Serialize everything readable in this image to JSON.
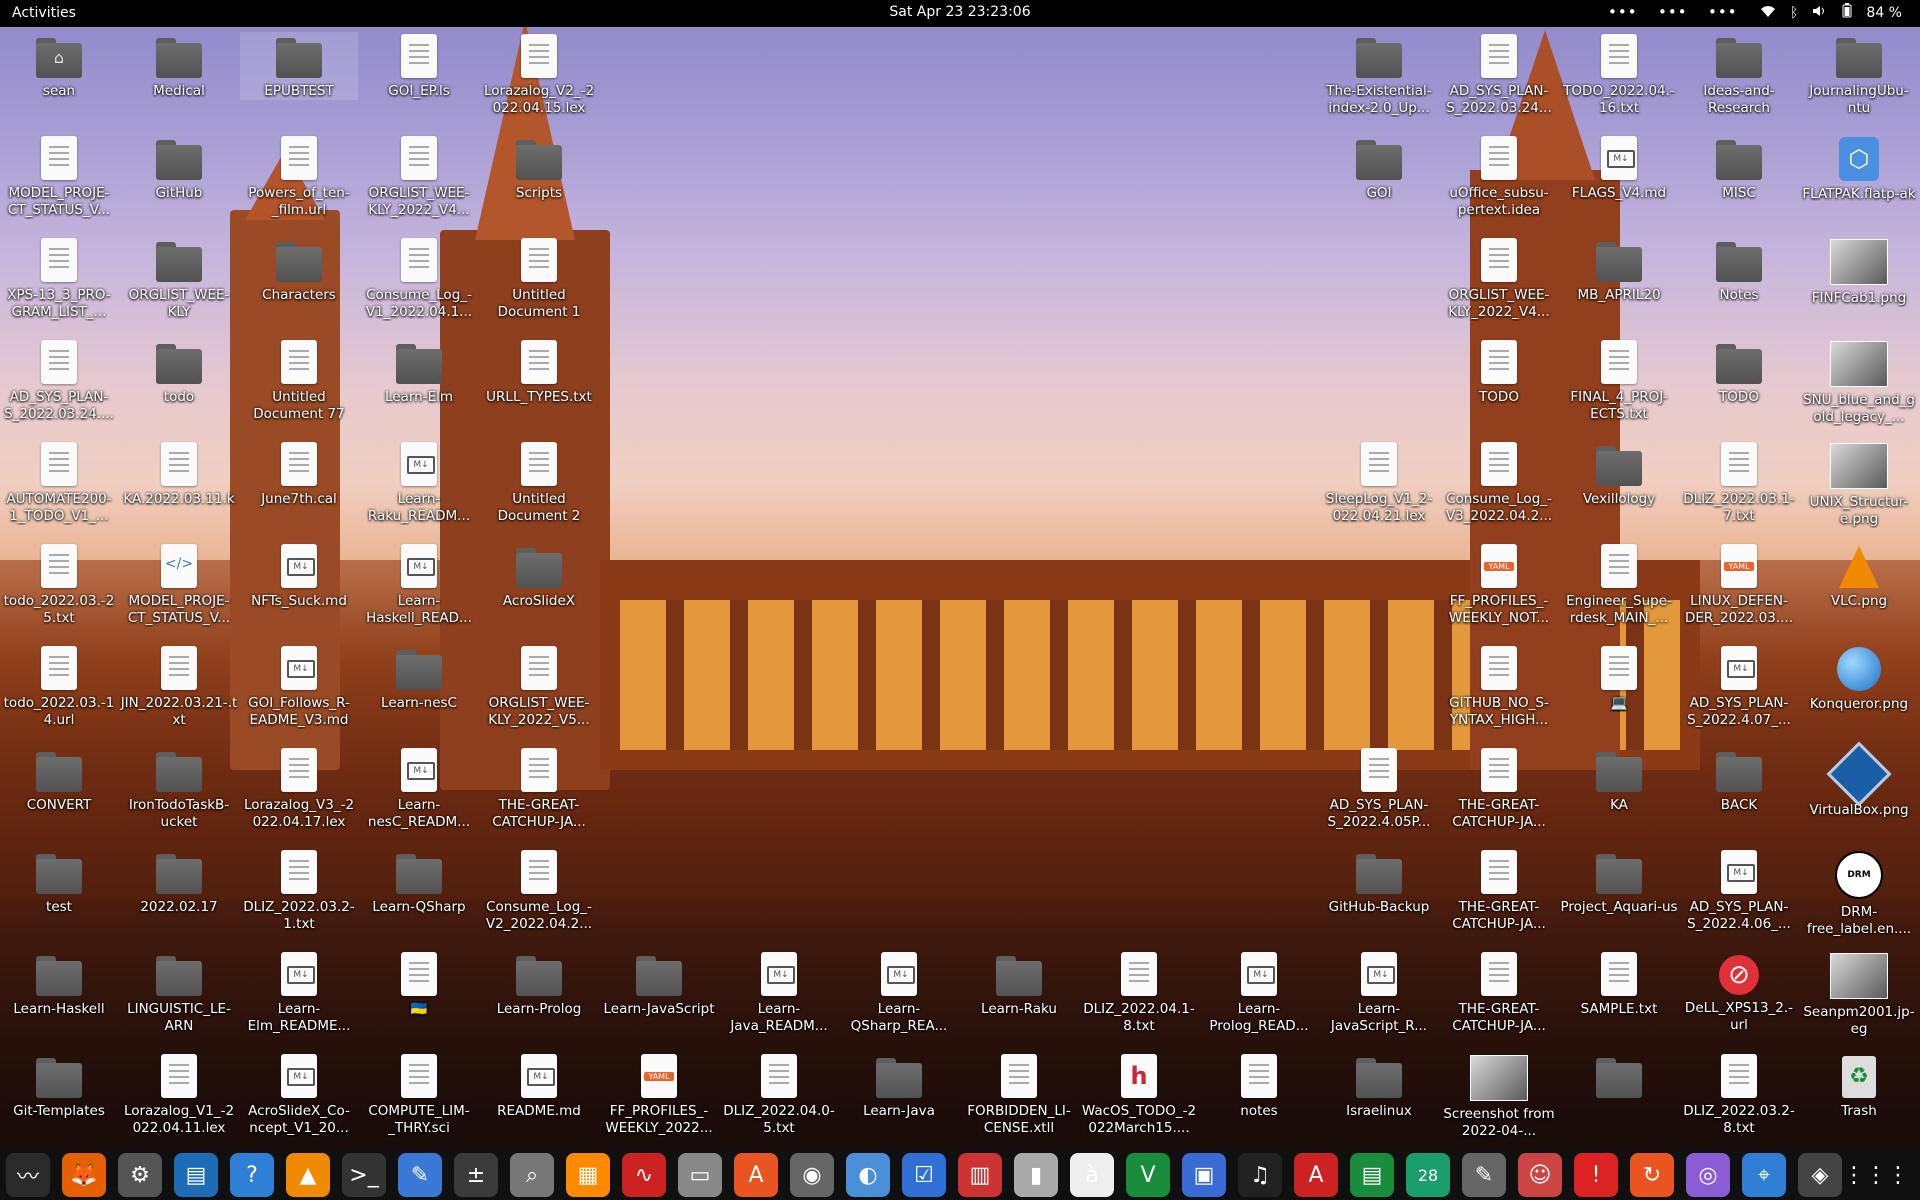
{
  "topbar": {
    "activities": "Activities",
    "clock": "Sat Apr 23  23:23:06",
    "battery": "84 %",
    "overflow": "•••"
  },
  "icons": [
    {
      "label": "sean",
      "kind": "home"
    },
    {
      "label": "Medical",
      "kind": "folder"
    },
    {
      "label": "EPUBTEST",
      "kind": "folder"
    },
    {
      "label": "GOI_EP.ls",
      "kind": "doc"
    },
    {
      "label": "Lorazalog_V2_-2022.04.15.lex",
      "kind": "doc"
    },
    {
      "label": "MODEL_PROJE-CT_STATUS_V...",
      "kind": "doc"
    },
    {
      "label": "GitHub",
      "kind": "folder"
    },
    {
      "label": "Powers_of_ten-_film.url",
      "kind": "doc"
    },
    {
      "label": "ORGLIST_WEE-KLY_2022_V4...",
      "kind": "doc"
    },
    {
      "label": "Scripts",
      "kind": "folder"
    },
    {
      "label": "XPS-13_3_PRO-GRAM_LIST_...",
      "kind": "doc"
    },
    {
      "label": "ORGLIST_WEE-KLY",
      "kind": "folder"
    },
    {
      "label": "Characters",
      "kind": "folder"
    },
    {
      "label": "Consume_Log_-V1_2022.04.1...",
      "kind": "doc"
    },
    {
      "label": "Untitled Document 1",
      "kind": "doc"
    },
    {
      "label": "AD_SYS_PLAN-S_2022.03.24....",
      "kind": "doc"
    },
    {
      "label": "todo",
      "kind": "folder"
    },
    {
      "label": "Untitled Document 77",
      "kind": "doc"
    },
    {
      "label": "Learn-Elm",
      "kind": "folder"
    },
    {
      "label": "URLL_TYPES.txt",
      "kind": "doc"
    },
    {
      "label": "AUTOMATE200-1_TODO_V1_...",
      "kind": "doc"
    },
    {
      "label": "KA.2022.03.11.k",
      "kind": "doc"
    },
    {
      "label": "June7th.cal",
      "kind": "doc"
    },
    {
      "label": "Learn-Raku_READM...",
      "kind": "md"
    },
    {
      "label": "Untitled Document 2",
      "kind": "doc"
    },
    {
      "label": "todo_2022.03.-25.txt",
      "kind": "doc"
    },
    {
      "label": "MODEL_PROJE-CT_STATUS_V...",
      "kind": "code"
    },
    {
      "label": "NFTs_Suck.md",
      "kind": "md"
    },
    {
      "label": "Learn-Haskell_READ...",
      "kind": "md"
    },
    {
      "label": "AcroSlideX",
      "kind": "folder"
    },
    {
      "label": "todo_2022.03.-14.url",
      "kind": "doc"
    },
    {
      "label": "JIN_2022.03.21-.txt",
      "kind": "doc"
    },
    {
      "label": "GOI_Follows_R-EADME_V3.md",
      "kind": "md"
    },
    {
      "label": "Learn-nesC",
      "kind": "folder"
    },
    {
      "label": "ORGLIST_WEE-KLY_2022_V5...",
      "kind": "doc"
    },
    {
      "label": "CONVERT",
      "kind": "folder"
    },
    {
      "label": "IronTodoTaskB-ucket",
      "kind": "folder"
    },
    {
      "label": "Lorazalog_V3_-2022.04.17.lex",
      "kind": "doc"
    },
    {
      "label": "Learn-nesC_READM...",
      "kind": "md"
    },
    {
      "label": "THE-GREAT-CATCHUP-JA...",
      "kind": "doc"
    },
    {
      "label": "test",
      "kind": "folder"
    },
    {
      "label": "2022.02.17",
      "kind": "folder"
    },
    {
      "label": "DLIZ_2022.03.2-1.txt",
      "kind": "doc"
    },
    {
      "label": "Learn-QSharp",
      "kind": "folder"
    },
    {
      "label": "Consume_Log_-V2_2022.04.2...",
      "kind": "doc"
    },
    {
      "label": "Learn-Haskell",
      "kind": "folder"
    },
    {
      "label": "LINGUISTIC_LE-ARN",
      "kind": "folder"
    },
    {
      "label": "Learn-Elm_README...",
      "kind": "md"
    },
    {
      "label": "🇺🇦",
      "kind": "doc"
    },
    {
      "label": "Learn-Prolog",
      "kind": "folder"
    },
    {
      "label": "Learn-JavaScript",
      "kind": "folder"
    },
    {
      "label": "Learn-Java_READM...",
      "kind": "md"
    },
    {
      "label": "Learn-QSharp_REA...",
      "kind": "md"
    },
    {
      "label": "Learn-Raku",
      "kind": "folder"
    },
    {
      "label": "DLIZ_2022.04.1-8.txt",
      "kind": "doc"
    },
    {
      "label": "Learn-Prolog_READ...",
      "kind": "md"
    },
    {
      "label": "Learn-JavaScript_R...",
      "kind": "md"
    },
    {
      "label": "THE-GREAT-CATCHUP-JA...",
      "kind": "doc"
    },
    {
      "label": "SAMPLE.txt",
      "kind": "doc"
    },
    {
      "label": "DeLL_XPS13_2.-url",
      "kind": "stop"
    },
    {
      "label": "Seanpm2001.jp-eg",
      "kind": "image"
    },
    {
      "label": "Git-Templates",
      "kind": "folder"
    },
    {
      "label": "Lorazalog_V1_-2022.04.11.lex",
      "kind": "doc"
    },
    {
      "label": "AcroSlideX_Co-ncept_V1_20...",
      "kind": "md"
    },
    {
      "label": "COMPUTE_LIM-_THRY.sci",
      "kind": "doc"
    },
    {
      "label": "README.md",
      "kind": "md"
    },
    {
      "label": "FF_PROFILES_-WEEKLY_2022...",
      "kind": "yaml"
    },
    {
      "label": "DLIZ_2022.04.0-5.txt",
      "kind": "doc"
    },
    {
      "label": "Learn-Java",
      "kind": "folder"
    },
    {
      "label": "FORBIDDEN_LI-CENSE.xtll",
      "kind": "doc"
    },
    {
      "label": "WacOS_TODO_-2022March15....",
      "kind": "h"
    },
    {
      "label": "notes",
      "kind": "doc"
    },
    {
      "label": "Israelinux",
      "kind": "folder"
    },
    {
      "label": "Screenshot from 2022-04-...",
      "kind": "image"
    },
    {
      "label": "",
      "kind": "folder"
    },
    {
      "label": "DLIZ_2022.03.2-8.txt",
      "kind": "doc"
    },
    {
      "label": "Trash",
      "kind": "trash"
    },
    {
      "label": "The-Existential-index-2.0_Up...",
      "kind": "folder"
    },
    {
      "label": "AD_SYS_PLAN-S_2022.03.24...",
      "kind": "doc"
    },
    {
      "label": "TODO_2022.04.-16.txt",
      "kind": "doc"
    },
    {
      "label": "Ideas-and-Research",
      "kind": "folder"
    },
    {
      "label": "JournalingUbu-ntu",
      "kind": "folder"
    },
    {
      "label": "GOI",
      "kind": "folder"
    },
    {
      "label": "uOffice_subsu-pertext.idea",
      "kind": "doc"
    },
    {
      "label": "FLAGS_V4.md",
      "kind": "md"
    },
    {
      "label": "MISC",
      "kind": "folder"
    },
    {
      "label": "FLATPAK.flatp-ak",
      "kind": "flatpak"
    },
    {
      "label": "ORGLIST_WEE-KLY_2022_V4...",
      "kind": "doc"
    },
    {
      "label": "MB_APRIL20",
      "kind": "folder"
    },
    {
      "label": "Notes",
      "kind": "folder"
    },
    {
      "label": "FINFCab1.png",
      "kind": "image"
    },
    {
      "label": "TODO",
      "kind": "doc"
    },
    {
      "label": "FINAL_4_PROJ-ECTS.txt",
      "kind": "doc"
    },
    {
      "label": "TODO",
      "kind": "folder"
    },
    {
      "label": "SNU_blue_and_gold_legacy_...",
      "kind": "image"
    },
    {
      "label": "SleepLog_V1_2-022.04.21.lex",
      "kind": "doc"
    },
    {
      "label": "Consume_Log_-V3_2022.04.2...",
      "kind": "doc"
    },
    {
      "label": "Vexillology",
      "kind": "folder"
    },
    {
      "label": "DLIZ_2022.03.1-7.txt",
      "kind": "doc"
    },
    {
      "label": "UNIX_Structur-e.png",
      "kind": "image"
    },
    {
      "label": "FF_PROFILES_-WEEKLY_NOT...",
      "kind": "yaml"
    },
    {
      "label": "Engineer_Supe-rdesk_MAIN_...",
      "kind": "doc"
    },
    {
      "label": "LINUX_DEFEN-DER_2022.03....",
      "kind": "yaml"
    },
    {
      "label": "VLC.png",
      "kind": "vlc"
    },
    {
      "label": "GITHUB_NO_S-YNTAX_HIGH...",
      "kind": "doc"
    },
    {
      "label": "💻",
      "kind": "doc"
    },
    {
      "label": "AD_SYS_PLAN-S_2022.4.07_...",
      "kind": "md"
    },
    {
      "label": "Konqueror.png",
      "kind": "globe"
    },
    {
      "label": "AD_SYS_PLAN-S_2022.4.05P...",
      "kind": "doc"
    },
    {
      "label": "THE-GREAT-CATCHUP-JA...",
      "kind": "doc"
    },
    {
      "label": "KA",
      "kind": "folder"
    },
    {
      "label": "BACK",
      "kind": "folder"
    },
    {
      "label": "VirtualBox.png",
      "kind": "vbox"
    },
    {
      "label": "GitHub-Backup",
      "kind": "folder"
    },
    {
      "label": "THE-GREAT-CATCHUP-JA...",
      "kind": "doc"
    },
    {
      "label": "Project_Aquari-us",
      "kind": "folder"
    },
    {
      "label": "AD_SYS_PLAN-S_2022.4.06_...",
      "kind": "md"
    },
    {
      "label": "DRM-free_label.en....",
      "kind": "drm"
    }
  ],
  "dock": [
    {
      "name": "system-monitor",
      "glyph": "〰",
      "color": "#2b2b2b"
    },
    {
      "name": "firefox",
      "glyph": "🦊",
      "color": "#e66000"
    },
    {
      "name": "settings",
      "glyph": "⚙",
      "color": "#555"
    },
    {
      "name": "libreoffice",
      "glyph": "▤",
      "color": "#1e6bb8"
    },
    {
      "name": "help",
      "glyph": "?",
      "color": "#2f7fd6"
    },
    {
      "name": "vlc",
      "glyph": "▲",
      "color": "#f08a00"
    },
    {
      "name": "terminal",
      "glyph": ">_",
      "color": "#333"
    },
    {
      "name": "text-editor",
      "glyph": "✎",
      "color": "#3a78d6"
    },
    {
      "name": "calculator",
      "glyph": "±",
      "color": "#3a3a3a"
    },
    {
      "name": "search",
      "glyph": "⌕",
      "color": "#777"
    },
    {
      "name": "impress",
      "glyph": "▦",
      "color": "#ff8a00"
    },
    {
      "name": "stats",
      "glyph": "∿",
      "color": "#c22"
    },
    {
      "name": "files",
      "glyph": "▭",
      "color": "#888"
    },
    {
      "name": "app-store",
      "glyph": "A",
      "color": "#e95420"
    },
    {
      "name": "disks",
      "glyph": "◉",
      "color": "#666"
    },
    {
      "name": "chromium",
      "glyph": "◐",
      "color": "#4a90d9"
    },
    {
      "name": "tasks",
      "glyph": "☑",
      "color": "#2f6fd6"
    },
    {
      "name": "calendar",
      "glyph": "▥",
      "color": "#c33"
    },
    {
      "name": "archive",
      "glyph": "▮",
      "color": "#aaa"
    },
    {
      "name": "fonts",
      "glyph": "à",
      "color": "#eee"
    },
    {
      "name": "vim",
      "glyph": "V",
      "color": "#1a8d3c"
    },
    {
      "name": "remote",
      "glyph": "▣",
      "color": "#3a6ad6"
    },
    {
      "name": "music",
      "glyph": "♫",
      "color": "#222"
    },
    {
      "name": "docs",
      "glyph": "A",
      "color": "#c22"
    },
    {
      "name": "sheets",
      "glyph": "▤",
      "color": "#1a8d3c"
    },
    {
      "name": "calendar-num",
      "glyph": "28",
      "color": "#1a9e6e"
    },
    {
      "name": "gimp",
      "glyph": "✎",
      "color": "#666"
    },
    {
      "name": "game",
      "glyph": "☺",
      "color": "#c44"
    },
    {
      "name": "alert",
      "glyph": "!",
      "color": "#d22"
    },
    {
      "name": "update",
      "glyph": "↻",
      "color": "#e95420"
    },
    {
      "name": "camera",
      "glyph": "◎",
      "color": "#8a5cd6"
    },
    {
      "name": "map",
      "glyph": "⌖",
      "color": "#2f7fd6"
    },
    {
      "name": "steam",
      "glyph": "◈",
      "color": "#444"
    },
    {
      "name": "apps-grid",
      "glyph": "⋮⋮⋮",
      "color": "#101010"
    }
  ]
}
